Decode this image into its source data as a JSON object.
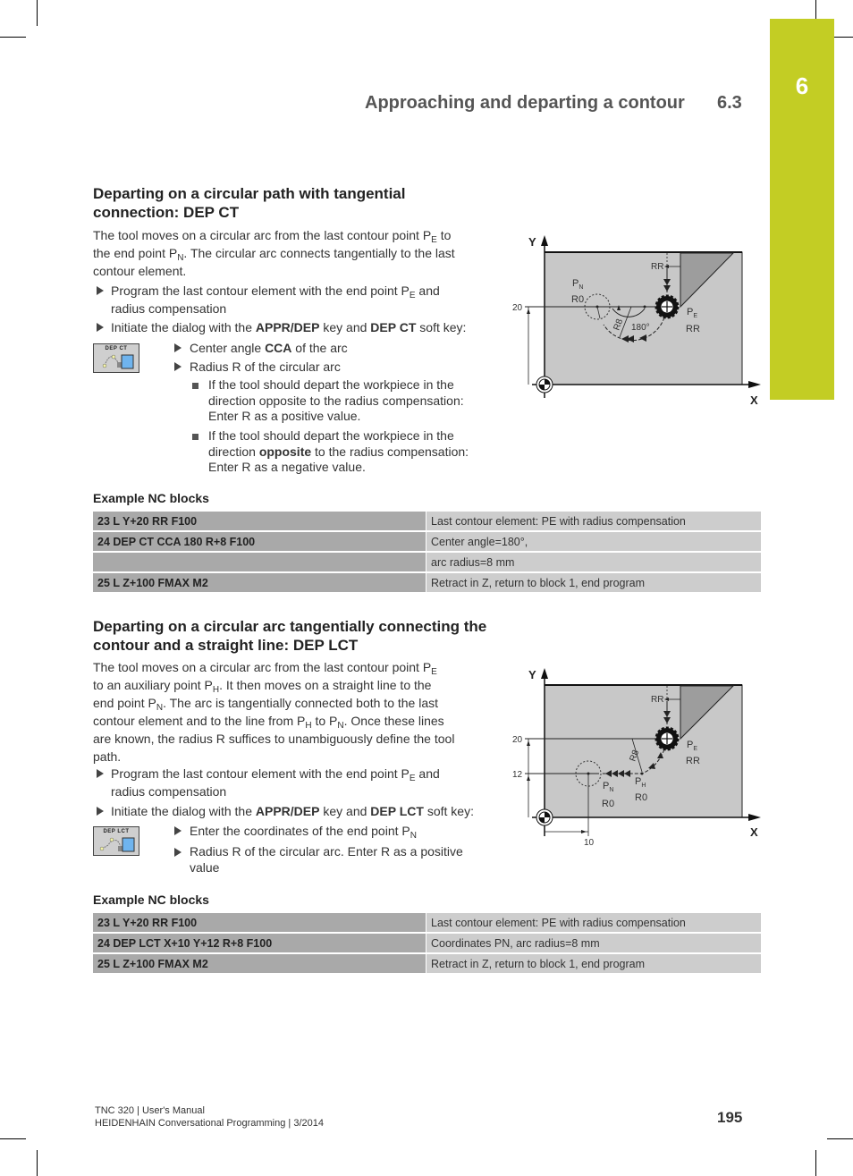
{
  "header": {
    "section_title": "Approaching and departing a contour",
    "section_number": "6.3",
    "chapter_number": "6",
    "chapter_color": "#c3cd24"
  },
  "section1": {
    "heading_line1": "Departing on a circular path with tangential",
    "heading_line2": "connection: DEP CT",
    "intro": {
      "l1_a": "The tool moves on a circular arc from the last contour point P",
      "l1_sub": "E",
      "l1_b": " to",
      "l2_a": "the end point P",
      "l2_sub": "N",
      "l2_b": ". The circular arc connects tangentially to the last",
      "l3": "contour element."
    },
    "steps": [
      {
        "a": "Program the last contour element with the end point P",
        "sub": "E",
        "b": " and",
        "c": "radius compensation"
      },
      {
        "a": "Initiate the dialog with the ",
        "bold1": "APPR/DEP",
        "b": " key and ",
        "bold2": "DEP CT",
        "c": " soft key:"
      }
    ],
    "softkey": {
      "label": "DEP CT",
      "icon": "dep-ct-softkey-icon"
    },
    "substeps": [
      {
        "a": "Center angle ",
        "bold": "CCA",
        "b": " of the arc"
      },
      {
        "a": "Radius R of the circular arc"
      }
    ],
    "notes": [
      {
        "l1": "If the tool should depart the workpiece in the",
        "l2": "direction opposite to the radius compensation:",
        "l3": "Enter R as a positive value."
      },
      {
        "l1": "If the tool should depart the workpiece in the",
        "l2a": "direction ",
        "l2bold": "opposite",
        "l2b": " to the radius compensation:",
        "l3": "Enter R as a negative value."
      }
    ],
    "diagram": {
      "axis_x": "X",
      "axis_y": "Y",
      "y_value": "20",
      "pn_label": "P",
      "pn_sub": "N",
      "pn_comp": "R0",
      "pe_label": "P",
      "pe_sub": "E",
      "pe_comp": "RR",
      "rr_label": "RR",
      "radius_label": "R8",
      "angle_label": "180°"
    },
    "example_title": "Example NC blocks",
    "nc_blocks": [
      {
        "code": "23 L Y+20 RR F100",
        "desc": "Last contour element: PE with radius compensation"
      },
      {
        "code": "24 DEP CT CCA 180 R+8 F100",
        "desc": "Center angle=180°,"
      },
      {
        "code": "",
        "desc": "arc radius=8 mm"
      },
      {
        "code": "25 L Z+100 FMAX M2",
        "desc": "Retract in Z, return to block 1, end program"
      }
    ]
  },
  "section2": {
    "heading_line1": "Departing on a circular arc tangentially connecting the",
    "heading_line2": "contour and a straight line: DEP LCT",
    "intro": {
      "l1_a": "The tool moves on a circular arc from the last contour point P",
      "l1_sub": "E",
      "l2_a": "to an auxiliary point P",
      "l2_sub": "H",
      "l2_b": ". It then moves on a straight line to the",
      "l3_a": "end point P",
      "l3_sub": "N",
      "l3_b": ". The arc is tangentially connected both to the last",
      "l4_a": "contour element and to the line from P",
      "l4_sub1": "H",
      "l4_b": " to P",
      "l4_sub2": "N",
      "l4_c": ". Once these lines",
      "l5": "are known, the radius R suffices to unambiguously define the tool",
      "l6": "path."
    },
    "steps": [
      {
        "a": "Program the last contour element with the end point P",
        "sub": "E",
        "b": " and",
        "c": "radius compensation"
      },
      {
        "a": "Initiate the dialog with the ",
        "bold1": "APPR/DEP",
        "b": " key and ",
        "bold2": "DEP LCT",
        "c": " soft key:"
      }
    ],
    "softkey": {
      "label": "DEP LCT",
      "icon": "dep-lct-softkey-icon"
    },
    "substeps": [
      {
        "a": "Enter the coordinates of the end point P",
        "sub": "N"
      },
      {
        "a": "Radius R of the circular arc. Enter R as a positive",
        "b": "value"
      }
    ],
    "diagram": {
      "axis_x": "X",
      "axis_y": "Y",
      "y_value_1": "20",
      "y_value_2": "12",
      "x_value": "10",
      "pn_label": "P",
      "pn_sub": "N",
      "pn_comp": "R0",
      "ph_label": "P",
      "ph_sub": "H",
      "ph_comp": "R0",
      "pe_label": "P",
      "pe_sub": "E",
      "pe_comp": "RR",
      "rr_label": "RR",
      "radius_label": "R8"
    },
    "example_title": "Example NC blocks",
    "nc_blocks": [
      {
        "code": "23 L Y+20 RR F100",
        "desc": "Last contour element: PE with radius compensation"
      },
      {
        "code": "24 DEP LCT X+10 Y+12 R+8 F100",
        "desc": "Coordinates PN, arc radius=8 mm"
      },
      {
        "code": "25 L Z+100 FMAX M2",
        "desc": "Retract in Z, return to block 1, end program"
      }
    ]
  },
  "footer": {
    "line1": "TNC 320 | User's Manual",
    "line2": "HEIDENHAIN Conversational Programming | 3/2014",
    "page_number": "195"
  }
}
